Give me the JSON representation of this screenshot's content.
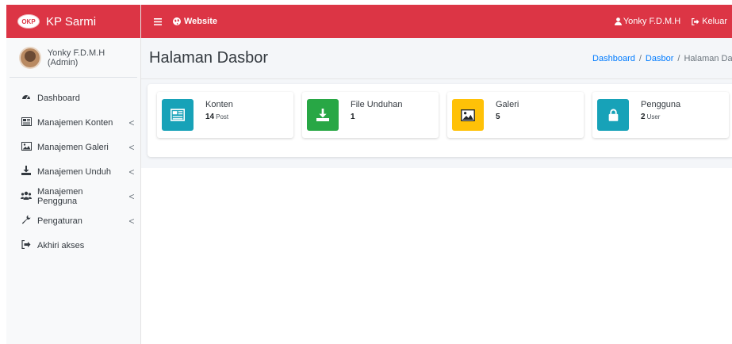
{
  "brand": {
    "logo_text": "OKP",
    "name": "KP Sarmi"
  },
  "user_panel": {
    "name": "Yonky F.D.M.H (Admin)"
  },
  "sidebar": {
    "items": [
      {
        "label": "Dashboard",
        "icon": "tachometer-icon",
        "has_children": false
      },
      {
        "label": "Manajemen Konten",
        "icon": "newspaper-icon",
        "has_children": true
      },
      {
        "label": "Manajemen Galeri",
        "icon": "image-icon",
        "has_children": true
      },
      {
        "label": "Manajemen Unduh",
        "icon": "download-icon",
        "has_children": true
      },
      {
        "label": "Manajemen Pengguna",
        "icon": "users-icon",
        "has_children": true
      },
      {
        "label": "Pengaturan",
        "icon": "wrench-icon",
        "has_children": true
      },
      {
        "label": "Akhiri akses",
        "icon": "sign-out-icon",
        "has_children": false
      }
    ],
    "chevron": "<"
  },
  "header": {
    "website_label": "Website",
    "user_label": "Yonky F.D.M.H",
    "logout_label": "Keluar"
  },
  "page": {
    "title": "Halaman Dasbor",
    "breadcrumb": [
      "Dashboard",
      "Dasbor",
      "Halaman Dasbor"
    ],
    "breadcrumb_sep": "/"
  },
  "info_boxes": [
    {
      "title": "Konten",
      "value": "14",
      "unit": "Post",
      "color": "#17a2b8",
      "icon": "newspaper-icon"
    },
    {
      "title": "File Unduhan",
      "value": "1",
      "unit": "",
      "color": "#28a745",
      "icon": "download-icon"
    },
    {
      "title": "Galeri",
      "value": "5",
      "unit": "",
      "color": "#ffc107",
      "icon": "image-icon"
    },
    {
      "title": "Pengguna",
      "value": "2",
      "unit": "User",
      "color": "#17a2b8",
      "icon": "lock-icon"
    }
  ],
  "colors": {
    "primary": "#dc3545",
    "sidebar_bg": "#f8f9fa",
    "content_bg": "#f4f6f9"
  }
}
